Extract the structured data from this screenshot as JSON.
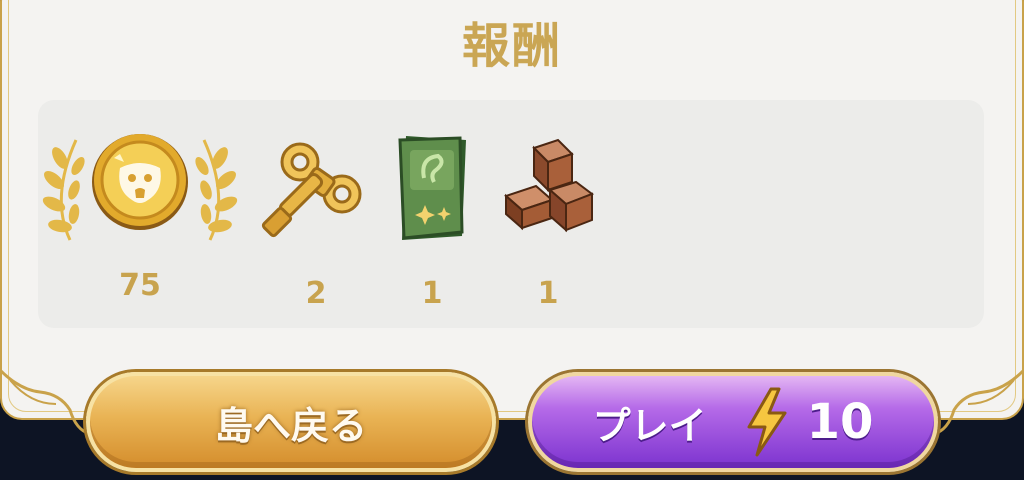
{
  "title": "報酬",
  "rewards": [
    {
      "icon": "gold-coin-laurel-icon",
      "count": "75"
    },
    {
      "icon": "wind-up-key-icon",
      "count": "2"
    },
    {
      "icon": "green-card-pack-icon",
      "count": "1"
    },
    {
      "icon": "brown-blocks-icon",
      "count": "1"
    }
  ],
  "buttons": {
    "back_label": "島へ戻る",
    "play_label": "プレイ",
    "play_cost": "10"
  },
  "colors": {
    "gold_text": "#caa654",
    "back_button": "#e9b354",
    "play_button": "#9b4fe0",
    "panel": "#f4f3f1"
  }
}
